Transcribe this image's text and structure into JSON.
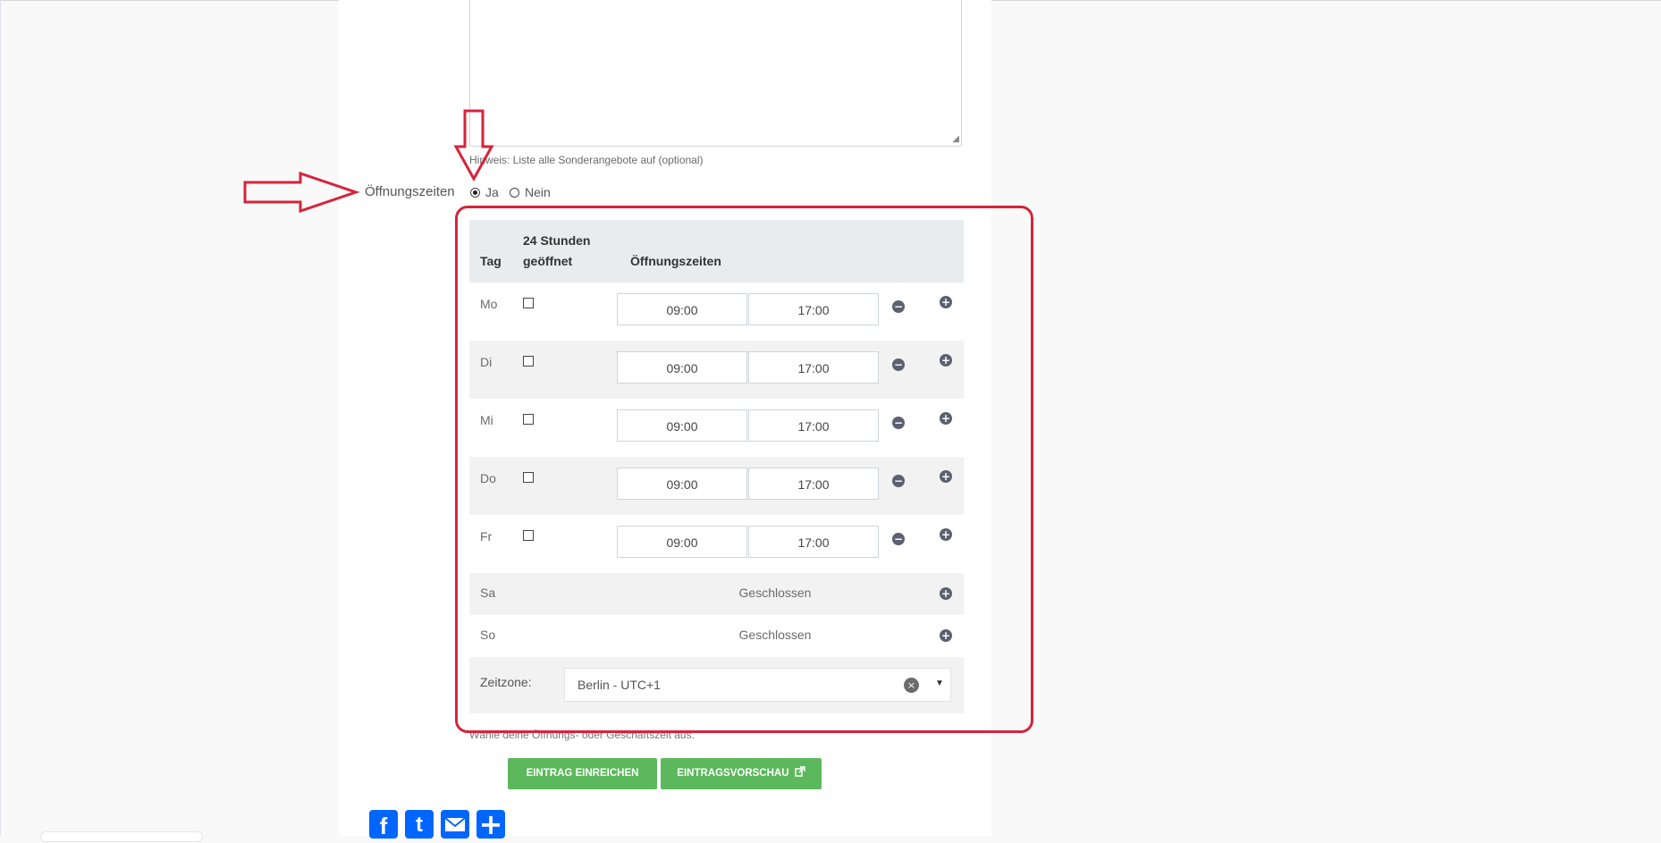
{
  "form": {
    "hint": "Hinweis: Liste alle Sonderangebote auf (optional)",
    "opening_hours_label": "Öffnungszeiten",
    "radio_yes": "Ja",
    "radio_no": "Nein",
    "selected": "Ja"
  },
  "table": {
    "col_day": "Tag",
    "col_24h_line1": "24 Stunden",
    "col_24h_line2": "geöffnet",
    "col_hours": "Öffnungszeiten",
    "rows": [
      {
        "day": "Mo",
        "open": "09:00",
        "close": "17:00"
      },
      {
        "day": "Di",
        "open": "09:00",
        "close": "17:00"
      },
      {
        "day": "Mi",
        "open": "09:00",
        "close": "17:00"
      },
      {
        "day": "Do",
        "open": "09:00",
        "close": "17:00"
      },
      {
        "day": "Fr",
        "open": "09:00",
        "close": "17:00"
      }
    ],
    "closed_rows": [
      {
        "day": "Sa",
        "status": "Geschlossen"
      },
      {
        "day": "So",
        "status": "Geschlossen"
      }
    ],
    "timezone_label": "Zeitzone:",
    "timezone_value": "Berlin - UTC+1",
    "clear_symbol": "×",
    "caret_symbol": "▼",
    "minus_symbol": "−",
    "plus_symbol": "+"
  },
  "note": "Wähle deine Öffnungs- oder Geschäftszeit aus.",
  "buttons": {
    "submit": "EINTRAG EINREICHEN",
    "preview": "EINTRAGSVORSCHAU"
  },
  "share": {
    "facebook_glyph": "f",
    "twitter_glyph": "t",
    "plus_glyph": "+"
  },
  "colors": {
    "annotation_red": "#d6243a",
    "button_green": "#5cb85c",
    "share_blue": "#0166ff"
  }
}
